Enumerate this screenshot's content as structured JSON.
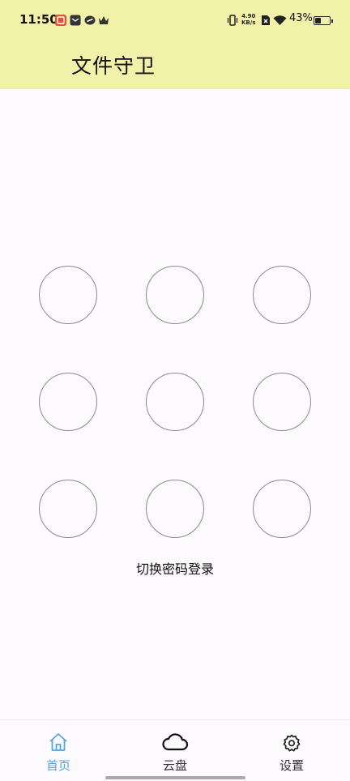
{
  "status_bar": {
    "time": "11:50",
    "speed_value": "4.90",
    "speed_unit": "KB/s",
    "battery": "43%",
    "battery_level": 0.43
  },
  "header": {
    "title": "文件守卫",
    "background": "#f2f1a9"
  },
  "pattern_lock": {
    "dots": [
      1,
      2,
      3,
      4,
      5,
      6,
      7,
      8,
      9
    ]
  },
  "switch_login_label": "切换密码登录",
  "bottom_nav": {
    "active_color": "#5aa3d8",
    "inactive_color": "#333333",
    "items": [
      {
        "label": "首页",
        "icon": "home-icon",
        "active": true
      },
      {
        "label": "云盘",
        "icon": "cloud-icon",
        "active": false
      },
      {
        "label": "设置",
        "icon": "gear-icon",
        "active": false
      }
    ]
  }
}
